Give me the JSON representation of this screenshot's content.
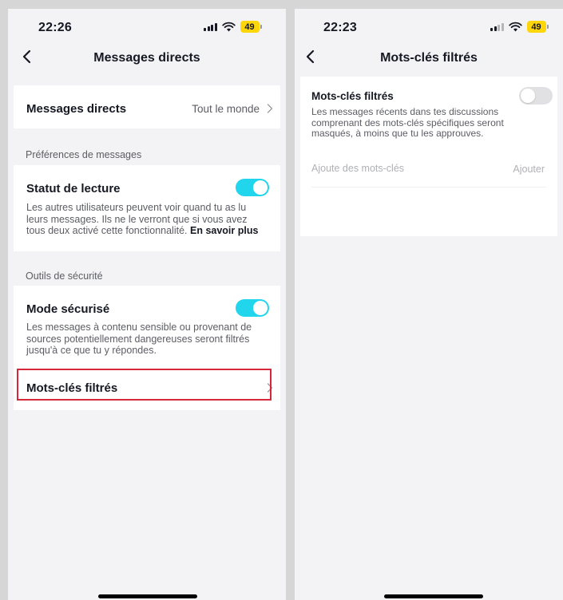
{
  "colors": {
    "accent": "#20d5ec",
    "highlight": "#d6283a",
    "battery": "#ffd60a"
  },
  "left_screen": {
    "status": {
      "time": "22:26",
      "battery": "49"
    },
    "nav": {
      "title": "Messages directs",
      "back_icon": "chevron-left-icon"
    },
    "direct_messages": {
      "label": "Messages directs",
      "value": "Tout le monde",
      "chevron_icon": "chevron-right-icon"
    },
    "message_prefs": {
      "section_label": "Préférences de messages",
      "read_status": {
        "title": "Statut de lecture",
        "toggle": "on",
        "description": "Les autres utilisateurs peuvent voir quand tu as lu leurs messages. Ils ne le verront que si vous avez tous deux activé cette fonctionnalité.",
        "learn_more": "En savoir plus"
      }
    },
    "safety_tools": {
      "section_label": "Outils de sécurité",
      "safe_mode": {
        "title": "Mode sécurisé",
        "toggle": "on",
        "description": "Les messages à contenu sensible ou provenant de sources potentiellement dangereuses seront filtrés jusqu'à ce que tu y répondes."
      },
      "filtered_keywords": {
        "label": "Mots-clés filtrés",
        "chevron_icon": "chevron-right-icon"
      }
    }
  },
  "right_screen": {
    "status": {
      "time": "22:23",
      "battery": "49"
    },
    "nav": {
      "title": "Mots-clés filtrés",
      "back_icon": "chevron-left-icon"
    },
    "filtered_keywords": {
      "title": "Mots-clés filtrés",
      "toggle": "off",
      "description": "Les messages récents dans tes discussions comprenant des mots-clés spécifiques seront masqués, à moins que tu les approuves.",
      "input_placeholder": "Ajoute des mots-clés",
      "add_label": "Ajouter"
    }
  }
}
